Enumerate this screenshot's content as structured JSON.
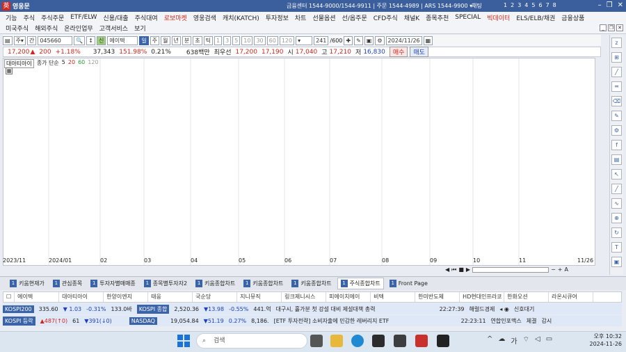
{
  "titlebar": {
    "app_title": "영웅문",
    "info": "금융센터 1544-9000/1544-9911 | 주문 1544-4989 | ARS 1544-9900 ▾",
    "channel": "채팅",
    "screens": [
      "1",
      "2",
      "3",
      "4",
      "5",
      "6",
      "7",
      "8"
    ]
  },
  "menu1": [
    "기능",
    "주식",
    "주식주문",
    "ETF/ELW",
    "신용/대출",
    "주식대여",
    "로보마켓",
    "영웅검색",
    "캐치(KATCH)",
    "투자정보",
    "차트",
    "선물옵션",
    "선/옵주문",
    "CFD주식",
    "채널K",
    "종목추천",
    "SPECIAL",
    "빅데이터",
    "ELS/ELB/채권",
    "금융상품"
  ],
  "menu1_red": [
    "로보마켓",
    "빅데이터"
  ],
  "menu2": [
    "미국주식",
    "해외주식",
    "온라인업무",
    "고객서비스",
    "보기"
  ],
  "toolbar": {
    "code": "045660",
    "name": "에이텍",
    "periods": [
      "일",
      "주",
      "월",
      "년",
      "분",
      "초",
      "틱"
    ],
    "ticks": [
      "1",
      "3",
      "5",
      "10",
      "30",
      "60",
      "120"
    ],
    "count": "241",
    "total": "/600",
    "date": "2024/11/26"
  },
  "quote": {
    "price": "17,200",
    "change": "200",
    "pct": "+1.18%",
    "volume": "37,343",
    "vol_ratio": "151.98%",
    "turnover": "0.21%",
    "amount": "638백만",
    "best": "최우선",
    "bid": "17,200",
    "ask": "17,190",
    "open_label": "시",
    "open": "17,040",
    "high_label": "고",
    "high": "17,210",
    "low_label": "저",
    "low": "16,830",
    "buy": "매수",
    "sell": "매도"
  },
  "legend": {
    "name": "대아티아이",
    "ma_label": "종가 단순",
    "ma": [
      "5",
      "20",
      "60",
      "120"
    ]
  },
  "xaxis": [
    "2023/11",
    "2024/01",
    "02",
    "03",
    "04",
    "05",
    "06",
    "07",
    "08",
    "09",
    "10",
    "11",
    "11/26"
  ],
  "tabs": [
    {
      "n": "1",
      "label": "키움현재가"
    },
    {
      "n": "1",
      "label": "관심종목"
    },
    {
      "n": "1",
      "label": "투자자별매매종"
    },
    {
      "n": "1",
      "label": "종목별투자자2"
    },
    {
      "n": "1",
      "label": "키움종합차트"
    },
    {
      "n": "1",
      "label": "키움종합차트"
    },
    {
      "n": "1",
      "label": "키움종합차트"
    },
    {
      "n": "1",
      "label": "주식종합차트"
    },
    {
      "n": "1",
      "label": "Front Page"
    }
  ],
  "watch": [
    "에이텍",
    "대아티아이",
    "한양이엔지",
    "태웅",
    "국순당",
    "지니뮤직",
    "링크제니시스",
    "피에이치에이",
    "비텍",
    "한미반도체",
    "HD현대인프라코",
    "한화오션",
    "라온시큐어"
  ],
  "ticker1": {
    "idx": "KOSPI200",
    "val": "335.60",
    "chg": "▼ 1.03",
    "pct": "-0.31%",
    "vol": "133.0바",
    "idx2": "KOSPI 종합",
    "val2": "2,520.36",
    "chg2": "▼13.98",
    "pct2": "-0.55%",
    "vol2": "441.억",
    "news": "대구시, 홀가분 첫 강설 대비 제설대책 총력",
    "time": "22:27:39",
    "src": "해럴드경제",
    "alert": "신호대기"
  },
  "ticker2": {
    "idx": "KOSPI 등락",
    "up": "▲487(↑0)",
    "flat": "61",
    "down": "▼391(↓0)",
    "idx2": "NASDAQ",
    "val2": "19,054.84",
    "chg2": "▼51.19",
    "pct2": "0.27%",
    "vol2": "8,186.",
    "news": "[ETF 투자전략] 소비자출에 민감한 레버리지 ETF",
    "time": "22:23:11",
    "src": "연합인포맥스",
    "b1": "체결",
    "b2": "감시"
  },
  "taskbar": {
    "search": "검색",
    "ime": "가",
    "time": "오후 10:32",
    "date": "2024-11-26"
  },
  "colors": {
    "titlebar": "#3b5e9c",
    "accent": "#3a63a8",
    "up": "#d0271c",
    "down": "#1e3fbf"
  }
}
